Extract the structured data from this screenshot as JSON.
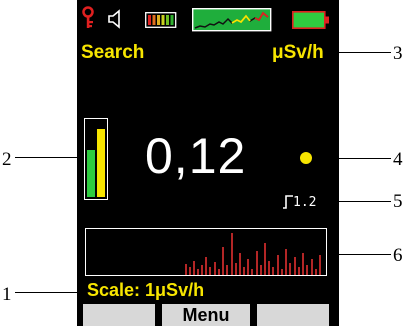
{
  "status_bar": {
    "icons": [
      "key-icon",
      "speaker-icon",
      "signal-level-icon",
      "spectrum-icon",
      "battery-icon"
    ],
    "colors": {
      "key": "#e02020",
      "battery": "#2ecc40",
      "spectrum_bg": "#1fae3c"
    }
  },
  "header": {
    "mode": "Search",
    "unit": "μSv/h"
  },
  "reading": {
    "value": "0,12",
    "indicator_color": "#f7e500",
    "threshold": "1.2"
  },
  "scale_label": "Scale: 1μSv/h",
  "softkeys": {
    "left": "",
    "center": "Menu",
    "right": ""
  },
  "bar_indicator": {
    "green_level": 0.62,
    "yellow_level": 0.9
  },
  "callouts": [
    "1",
    "2",
    "3",
    "4",
    "5",
    "6"
  ],
  "colors": {
    "screen": "#000000",
    "text": "#f7e500",
    "value": "#ffffff",
    "history": "#e03030"
  }
}
